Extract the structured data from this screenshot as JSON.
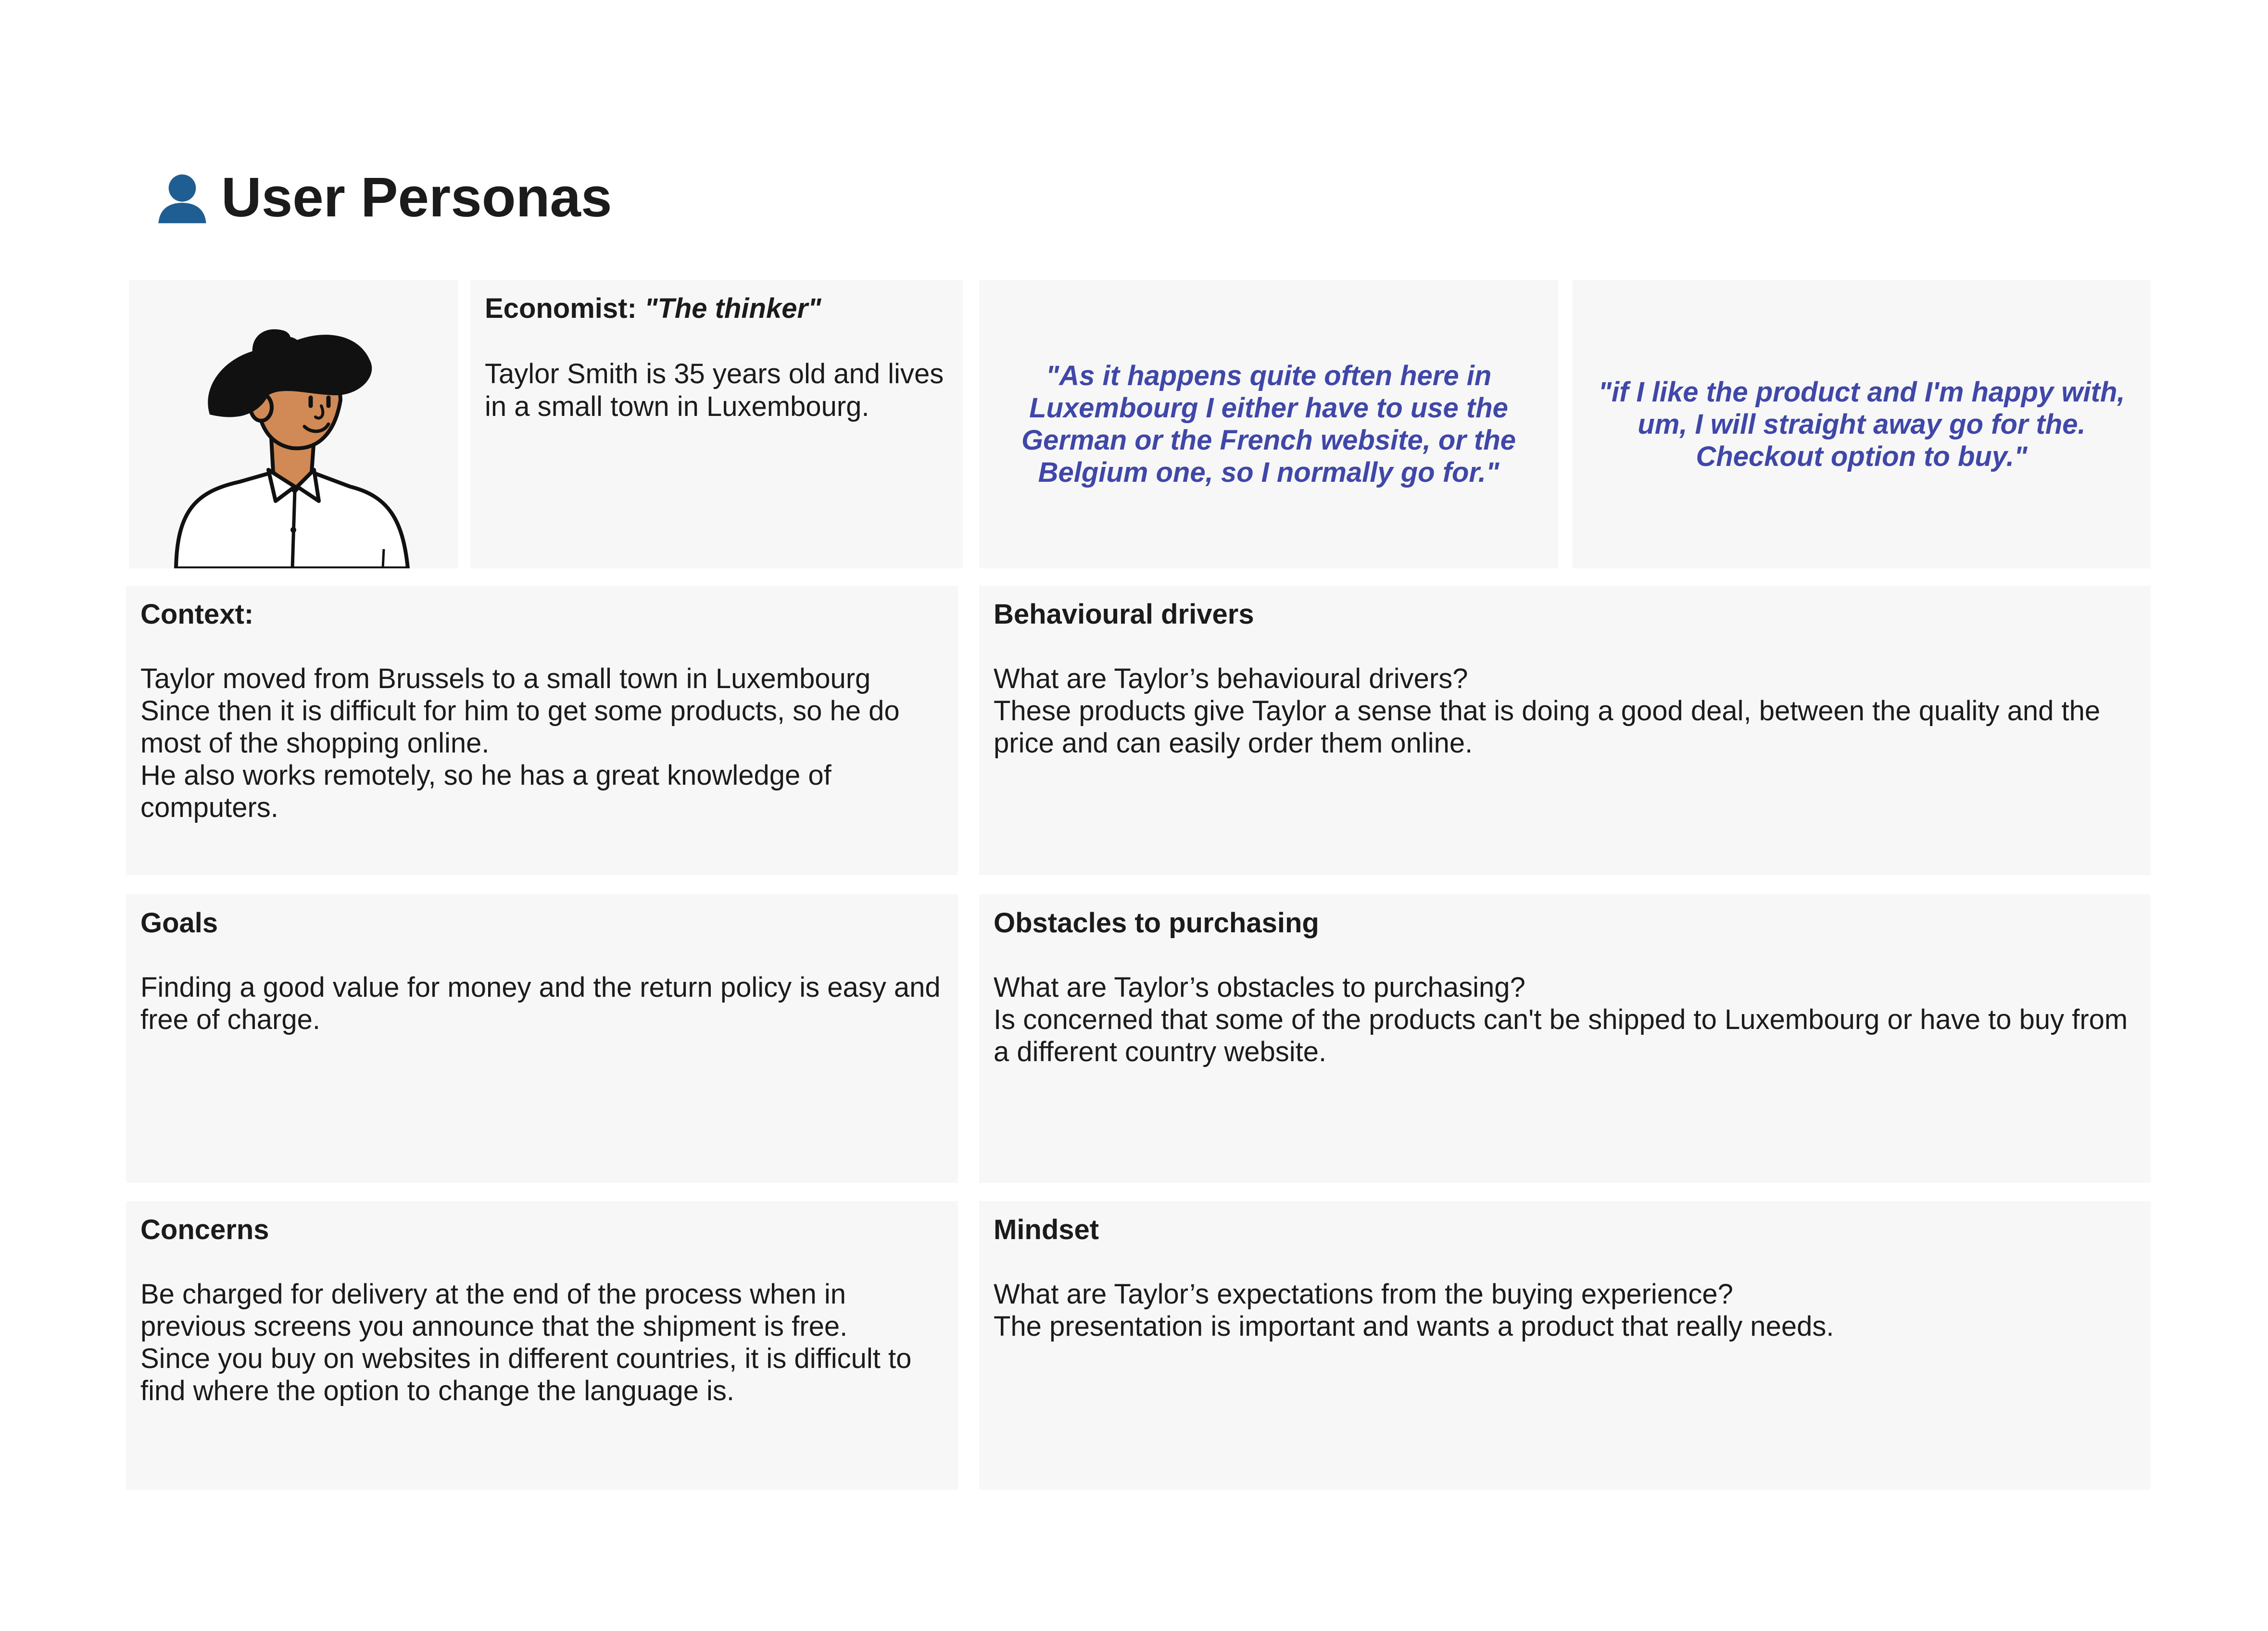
{
  "header": {
    "icon": "user-silhouette-icon",
    "title": "User Personas"
  },
  "persona": {
    "avatar": "person-with-hat-illustration",
    "role": "Economist:",
    "nickname": "\"The thinker\"",
    "intro": "Taylor Smith is 35 years old and lives in a small town in Luxembourg."
  },
  "quotes": [
    "\"As it happens quite often here in Luxembourg I either have to use the German or the French website, or the Belgium one, so I normally go for.\"",
    "\"if I like the product and I'm happy with, um, I will straight away go for the. Checkout option to buy.\""
  ],
  "sections": {
    "context": {
      "title": "Context:",
      "lines": [
        "Taylor moved from Brussels to a small town in Luxembourg",
        "Since then it is difficult for him to get some products, so he do most of the shopping online.",
        "He also works remotely, so he has a great knowledge of computers."
      ]
    },
    "drivers": {
      "title": "Behavioural drivers",
      "lines": [
        "What are Taylor’s behavioural drivers?",
        "These products give Taylor a sense that is doing a good deal, between the quality and the price and can easily order them online."
      ]
    },
    "goals": {
      "title": "Goals",
      "lines": [
        "Finding a good value for money and the return policy is easy and free of charge."
      ]
    },
    "obstacles": {
      "title": "Obstacles to purchasing",
      "lines": [
        "What are Taylor’s obstacles to purchasing?",
        "Is concerned that some of the products can't be shipped to Luxembourg or have to buy from a different country website."
      ]
    },
    "concerns": {
      "title": "Concerns",
      "lines": [
        "Be charged for delivery at the end of the process when in previous screens you announce that the shipment is free.",
        "Since you buy on websites in different countries, it is difficult to find where the option to change the language is."
      ]
    },
    "mindset": {
      "title": "Mindset",
      "lines": [
        "What are Taylor’s expectations from the buying experience?",
        "The presentation is important and wants a product that really needs."
      ]
    }
  },
  "colors": {
    "card_background": "#f7f7f7",
    "quote_text": "#3f47a8",
    "title_icon": "#1f5e93",
    "body_text": "#1b1b1b"
  }
}
